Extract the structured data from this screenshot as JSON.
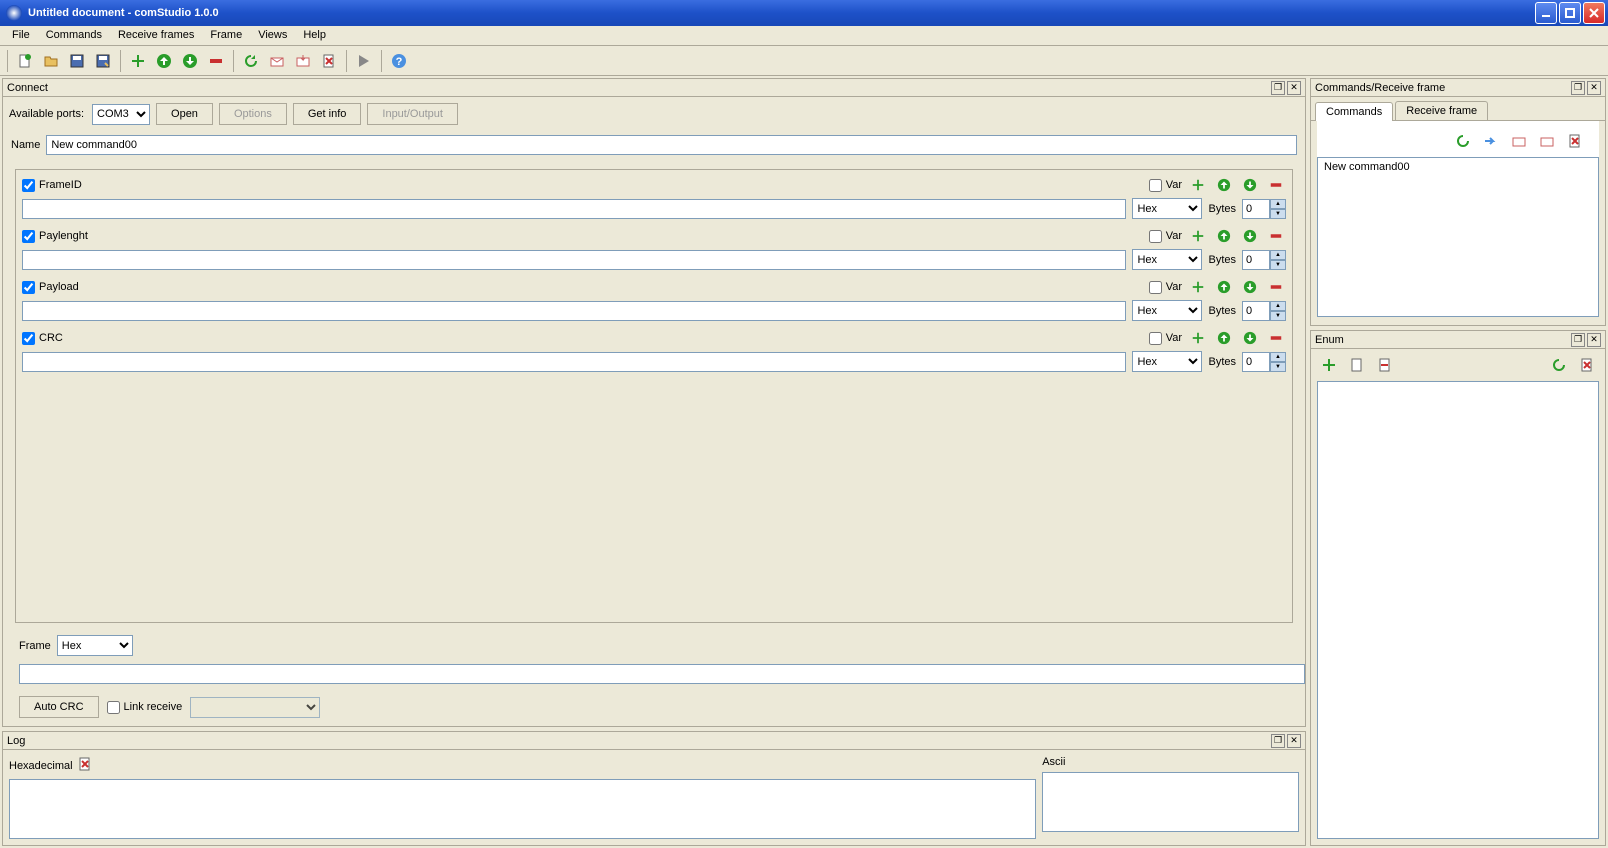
{
  "window": {
    "title": "Untitled document - comStudio 1.0.0"
  },
  "menu": {
    "file": "File",
    "commands": "Commands",
    "receive_frames": "Receive frames",
    "frame": "Frame",
    "views": "Views",
    "help": "Help"
  },
  "connect": {
    "panel_title": "Connect",
    "available_ports_label": "Available ports:",
    "port_value": "COM3",
    "open_btn": "Open",
    "options_btn": "Options",
    "getinfo_btn": "Get info",
    "io_btn": "Input/Output"
  },
  "form": {
    "name_label": "Name",
    "name_value": "New command00",
    "var_label": "Var",
    "bytes_label": "Bytes",
    "hex_option": "Hex",
    "bytes_value": "0",
    "fields": {
      "frameid": {
        "label": "FrameID",
        "checked": true
      },
      "paylenght": {
        "label": "Paylenght",
        "checked": true
      },
      "payload": {
        "label": "Payload",
        "checked": true
      },
      "crc": {
        "label": "CRC",
        "checked": true
      }
    },
    "frame_label": "Frame",
    "frame_fmt": "Hex",
    "autocrc_btn": "Auto CRC",
    "link_receive_label": "Link receive"
  },
  "rightpanel": {
    "cmdrec_title": "Commands/Receive frame",
    "tab_commands": "Commands",
    "tab_receive": "Receive frame",
    "cmd_items": [
      "New command00"
    ],
    "enum_title": "Enum"
  },
  "log": {
    "panel_title": "Log",
    "hex_label": "Hexadecimal",
    "ascii_label": "Ascii"
  }
}
